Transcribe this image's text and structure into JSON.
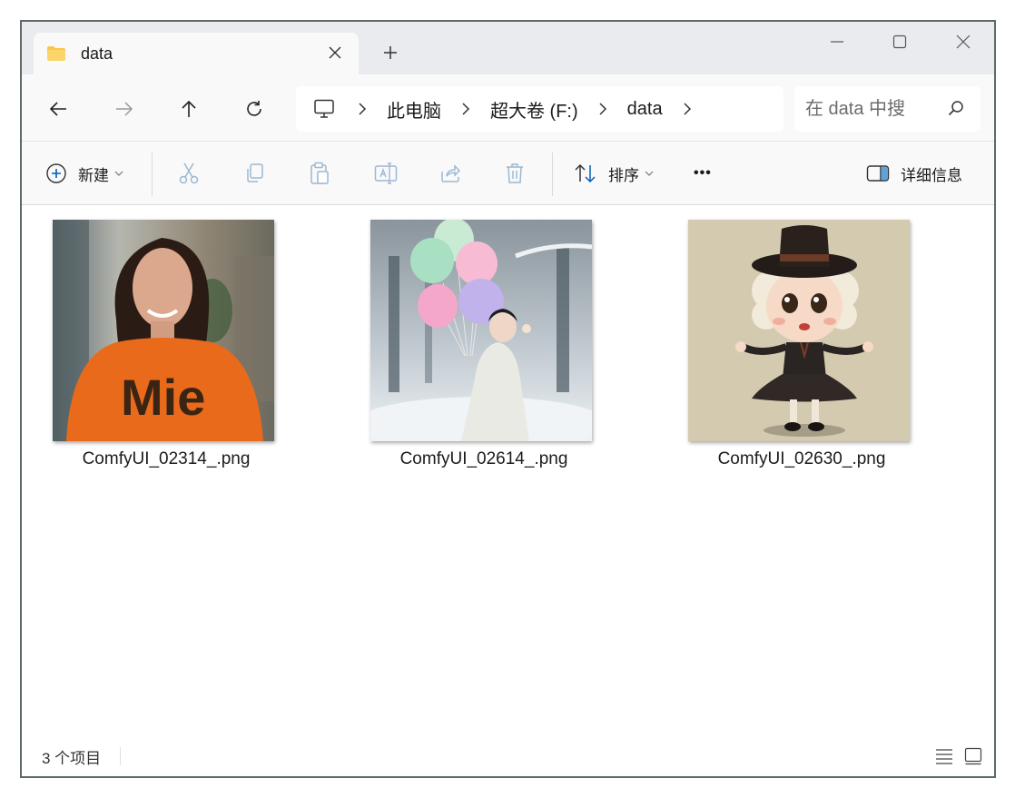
{
  "window": {
    "tab_title": "data",
    "new_tab_label": "+"
  },
  "address": {
    "crumbs": [
      "此电脑",
      "超大卷 (F:)",
      "data"
    ]
  },
  "search": {
    "placeholder": "在 data 中搜"
  },
  "toolbar": {
    "new_label": "新建",
    "sort_label": "排序",
    "more_label": "•••",
    "details_label": "详细信息"
  },
  "files": [
    {
      "name": "ComfyUI_02314_.png"
    },
    {
      "name": "ComfyUI_02614_.png"
    },
    {
      "name": "ComfyUI_02630_.png"
    }
  ],
  "status": {
    "item_count": "3 个项目"
  },
  "colors": {
    "accent": "#005fb8",
    "folder": "#f8c74a",
    "disabled_icon": "#9cb8d3"
  }
}
